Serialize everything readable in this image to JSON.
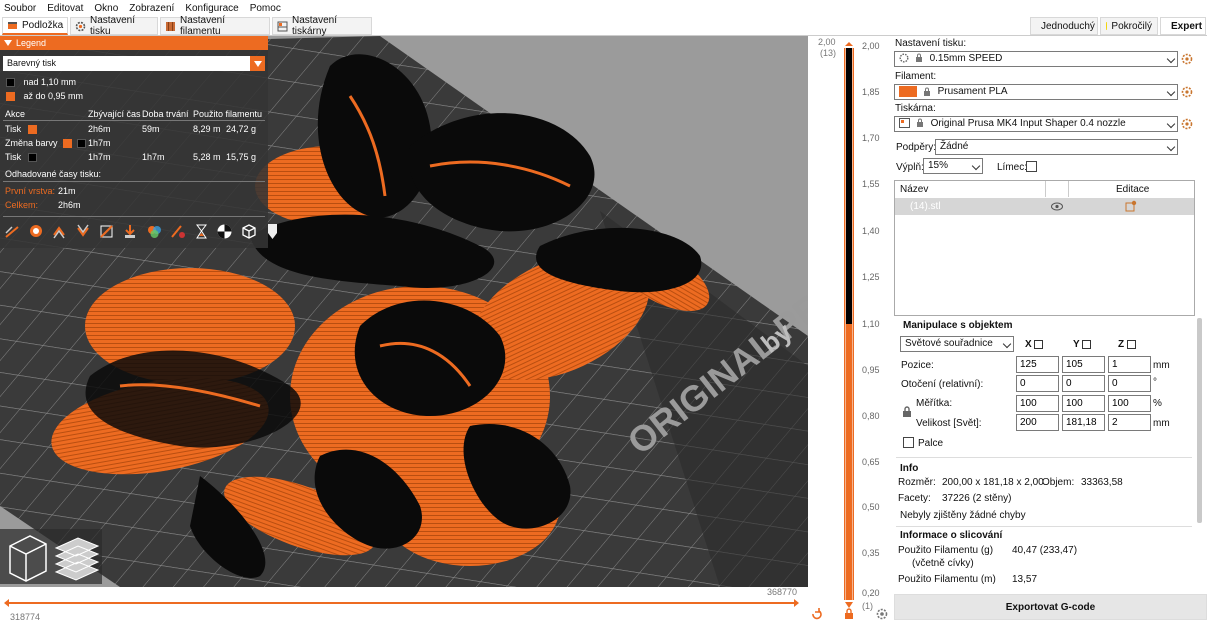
{
  "menu": [
    "Soubor",
    "Editovat",
    "Okno",
    "Zobrazení",
    "Konfigurace",
    "Pomoc"
  ],
  "tabs": [
    {
      "label": "Podložka",
      "active": true
    },
    {
      "label": "Nastavení tisku",
      "active": false
    },
    {
      "label": "Nastavení filamentu",
      "active": false
    },
    {
      "label": "Nastavení tiskárny",
      "active": false
    }
  ],
  "modes": [
    {
      "label": "Jednoduchý",
      "color": "#42b742"
    },
    {
      "label": "Pokročilý",
      "color": "#f2d50a"
    },
    {
      "label": "Expert",
      "color": "#d7141a",
      "active": true
    }
  ],
  "legend": {
    "title": "Legend",
    "view_type": "Barevný tisk",
    "ranges": [
      {
        "label": "nad 1,10 mm",
        "color": "#000000"
      },
      {
        "label": "až do 0,95 mm",
        "color": "#ed6b21"
      }
    ],
    "columns": [
      "Akce",
      "Zbývající čas",
      "Doba trvání",
      "Použito filamentu"
    ],
    "rows": [
      {
        "action": "Tisk",
        "swatches": [
          "#ed6b21"
        ],
        "remaining": "2h6m",
        "duration": "59m",
        "length": "8,29 m",
        "weight": "24,72 g"
      },
      {
        "action": "Změna barvy",
        "swatches": [
          "#ed6b21",
          "#000000"
        ],
        "remaining": "1h7m",
        "duration": "",
        "length": "",
        "weight": ""
      },
      {
        "action": "Tisk",
        "swatches": [
          "#000000"
        ],
        "remaining": "1h7m",
        "duration": "1h7m",
        "length": "5,28 m",
        "weight": "15,75 g"
      }
    ],
    "estimated_title": "Odhadované časy tisku:",
    "first_layer_label": "První vrstva:",
    "first_layer_value": "21m",
    "total_label": "Celkem:",
    "total_value": "2h6m"
  },
  "scene": {
    "bed_text_main": "ORIGINAL PRUSA M",
    "bed_text_sub": "by"
  },
  "layer_slider": {
    "top_value": "2,00",
    "top_layer": "(13)",
    "bottom_value": "0,20",
    "bottom_layer": "(1)",
    "ticks": [
      "2,00",
      "1,85",
      "1,70",
      "1,55",
      "1,40",
      "1,25",
      "1,10",
      "0,95",
      "0,80",
      "0,65",
      "0,50",
      "0,35",
      "0,20"
    ]
  },
  "h_slider": {
    "left_value": "318774",
    "right_value": "368770"
  },
  "panel": {
    "print_settings_label": "Nastavení tisku:",
    "print_profile": "0.15mm SPEED",
    "filament_label": "Filament:",
    "filament_profile": "Prusament PLA",
    "filament_color": "#ed6b21",
    "printer_label": "Tiskárna:",
    "printer_profile": "Original Prusa MK4 Input Shaper 0.4 nozzle",
    "supports_label": "Podpěry:",
    "supports_value": "Žádné",
    "infill_label": "Výplň:",
    "infill_value": "15%",
    "brim_label": "Límec:",
    "list_col_name": "Název",
    "list_col_edit": "Editace",
    "object_name": "(14).stl",
    "manip_title": "Manipulace s objektem",
    "coord_system": "Světové souřadnice",
    "axis_x": "X",
    "axis_y": "Y",
    "axis_z": "Z",
    "position_label": "Pozice:",
    "position": [
      "125",
      "105",
      "1"
    ],
    "position_unit": "mm",
    "rotation_label": "Otočení (relativní):",
    "rotation": [
      "0",
      "0",
      "0"
    ],
    "rotation_unit": "°",
    "scale_label": "Měřítka:",
    "scale": [
      "100",
      "100",
      "100"
    ],
    "scale_unit": "%",
    "size_label": "Velikost [Svět]:",
    "size": [
      "200",
      "181,18",
      "2"
    ],
    "size_unit": "mm",
    "inches_label": "Palce",
    "info_title": "Info",
    "size_info_label": "Rozměr:",
    "size_info_value": "200,00 x 181,18 x 2,00",
    "volume_label": "Objem:",
    "volume_value": "33363,58",
    "facets_label": "Facety:",
    "facets_value": "37226 (2 stěny)",
    "errors_text": "Nebyly zjištěny žádné chyby",
    "slice_title": "Informace o slicování",
    "filament_g_label": "Použito Filamentu (g)",
    "filament_g_value": "40,47 (233,47)",
    "spool_label": "(včetně cívky)",
    "filament_m_label": "Použito Filamentu (m)",
    "filament_m_value": "13,57",
    "export_label": "Exportovat G-code"
  },
  "colors": {
    "accent": "#ed6b21",
    "dark": "#000000"
  }
}
